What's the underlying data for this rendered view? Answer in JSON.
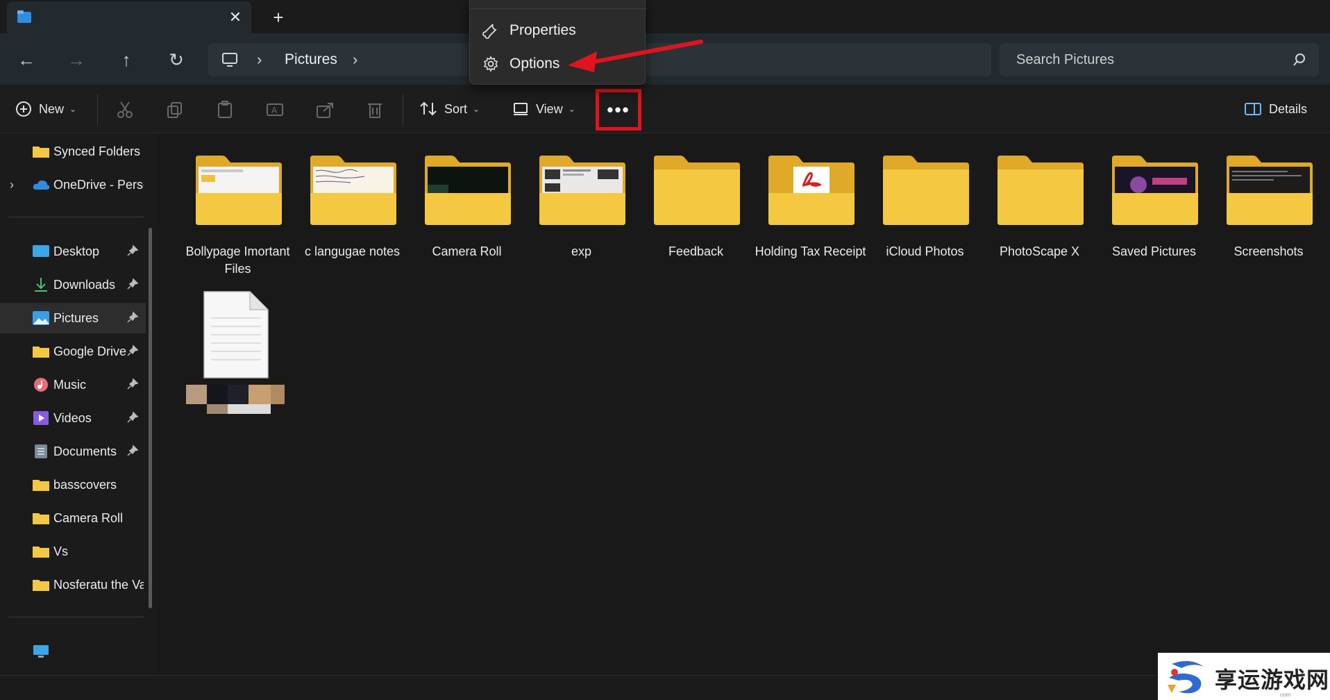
{
  "window": {
    "tab_close_glyph": "✕",
    "new_tab_glyph": "+"
  },
  "nav": {
    "back": "←",
    "forward": "→",
    "up": "↑",
    "refresh": "↻"
  },
  "address": {
    "chevron": "›",
    "location": "Pictures"
  },
  "search": {
    "placeholder": "Search Pictures"
  },
  "toolbar": {
    "new_label": "New",
    "sort_label": "Sort",
    "view_label": "View",
    "more_label": "•••",
    "details_label": "Details",
    "dropdown_glyph": "⌄"
  },
  "context_menu": {
    "items": [
      {
        "label": "Properties",
        "icon": "wrench-icon"
      },
      {
        "label": "Options",
        "icon": "gear-icon"
      }
    ]
  },
  "sidebar": {
    "top_items": [
      {
        "label": "Synced Folders",
        "icon": "folder-icon"
      },
      {
        "label": "OneDrive - Personal",
        "icon": "cloud-icon"
      }
    ],
    "pinned_items": [
      {
        "label": "Desktop",
        "icon": "desktop-icon"
      },
      {
        "label": "Downloads",
        "icon": "download-icon"
      },
      {
        "label": "Pictures",
        "icon": "pictures-icon"
      },
      {
        "label": "Google Drive",
        "icon": "folder-icon"
      },
      {
        "label": "Music",
        "icon": "music-icon"
      },
      {
        "label": "Videos",
        "icon": "videos-icon"
      },
      {
        "label": "Documents",
        "icon": "documents-icon"
      },
      {
        "label": "basscovers",
        "icon": "folder-icon"
      },
      {
        "label": "Camera Roll",
        "icon": "folder-icon"
      },
      {
        "label": "Vs",
        "icon": "folder-icon"
      },
      {
        "label": "Nosferatu the Vampyre",
        "icon": "folder-icon"
      }
    ]
  },
  "folders": [
    {
      "name": "Bollypage Imortant Files"
    },
    {
      "name": "c langugae notes"
    },
    {
      "name": "Camera Roll"
    },
    {
      "name": "exp"
    },
    {
      "name": "Feedback"
    },
    {
      "name": "Holding Tax Receipt"
    },
    {
      "name": "iCloud Photos"
    },
    {
      "name": "PhotoScape X"
    },
    {
      "name": "Saved Pictures"
    },
    {
      "name": "Screenshots"
    }
  ],
  "watermark": {
    "text": "享运游戏网",
    "sub": "com"
  },
  "colors": {
    "highlight_red": "#e0141e",
    "folder_yellow": "#f5c842",
    "folder_back": "#e0a92a",
    "background": "#191919"
  }
}
